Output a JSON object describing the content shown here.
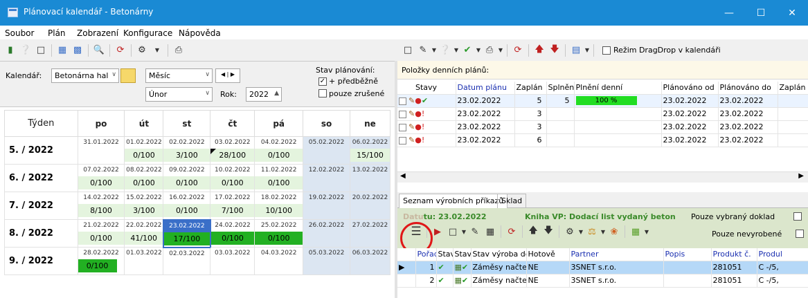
{
  "window": {
    "title": "Plánovací kalendář - Betonárny"
  },
  "menu": [
    "Soubor",
    "Plán",
    "Zobrazení",
    "Konfigurace",
    "Nápověda"
  ],
  "dragdrop_label": "Režim DragDrop v kalendáři",
  "controls": {
    "calendar_label": "Kalendář:",
    "calendar_value": "Betonárna hal",
    "view_value": "Měsíc",
    "month_value": "Únor",
    "year_label": "Rok:",
    "year_value": "2022",
    "state_label": "Stav plánování:",
    "opt_prelim": "+ předběžně",
    "opt_cancelled": "pouze zrušené"
  },
  "calendar": {
    "headers": [
      "Týden",
      "po",
      "út",
      "st",
      "čt",
      "pá",
      "so",
      "ne"
    ],
    "weeks": [
      {
        "label": "5. / 2022",
        "days": [
          [
            "31.01.2022",
            ""
          ],
          [
            "01.02.2022",
            "0/100"
          ],
          [
            "02.02.2022",
            "3/100"
          ],
          [
            "03.02.2022",
            "28/100"
          ],
          [
            "04.02.2022",
            "0/100"
          ],
          [
            "05.02.2022",
            ""
          ],
          [
            "06.02.2022",
            "15/100"
          ]
        ]
      },
      {
        "label": "6. / 2022",
        "days": [
          [
            "07.02.2022",
            "0/100"
          ],
          [
            "08.02.2022",
            "0/100"
          ],
          [
            "09.02.2022",
            "0/100"
          ],
          [
            "10.02.2022",
            "0/100"
          ],
          [
            "11.02.2022",
            "0/100"
          ],
          [
            "12.02.2022",
            ""
          ],
          [
            "13.02.2022",
            ""
          ]
        ]
      },
      {
        "label": "7. / 2022",
        "days": [
          [
            "14.02.2022",
            "8/100"
          ],
          [
            "15.02.2022",
            "3/100"
          ],
          [
            "16.02.2022",
            "0/100"
          ],
          [
            "17.02.2022",
            "7/100"
          ],
          [
            "18.02.2022",
            "10/100"
          ],
          [
            "19.02.2022",
            ""
          ],
          [
            "20.02.2022",
            ""
          ]
        ]
      },
      {
        "label": "8. / 2022",
        "days": [
          [
            "21.02.2022",
            "0/100"
          ],
          [
            "22.02.2022",
            "41/100"
          ],
          [
            "23.02.2022",
            "17/100"
          ],
          [
            "24.02.2022",
            "0/100"
          ],
          [
            "25.02.2022",
            "0/100"
          ],
          [
            "26.02.2022",
            ""
          ],
          [
            "27.02.2022",
            ""
          ]
        ]
      },
      {
        "label": "9. / 2022",
        "days": [
          [
            "28.02.2022",
            "0/100"
          ],
          [
            "01.03.2022",
            ""
          ],
          [
            "02.03.2022",
            ""
          ],
          [
            "03.03.2022",
            ""
          ],
          [
            "04.03.2022",
            ""
          ],
          [
            "05.03.2022",
            ""
          ],
          [
            "06.03.2022",
            ""
          ]
        ]
      }
    ]
  },
  "daily": {
    "title": "Položky denních plánů:",
    "columns": [
      "Stavy",
      "Datum plánu",
      "Zaplán",
      "Splněn",
      "Plnění denní",
      "Plánováno od",
      "Plánováno do",
      "Zaplán"
    ],
    "rows": [
      [
        "23.02.2022",
        "5",
        "5",
        "100 %",
        "23.02.2022",
        "23.02.2022"
      ],
      [
        "23.02.2022",
        "3",
        "",
        "",
        "23.02.2022",
        "23.02.2022"
      ],
      [
        "23.02.2022",
        "3",
        "",
        "",
        "23.02.2022",
        "23.02.2022"
      ],
      [
        "23.02.2022",
        "6",
        "",
        "",
        "23.02.2022",
        "23.02.2022"
      ]
    ],
    "progress": [
      1.0,
      0,
      0,
      0
    ]
  },
  "tabs": [
    "Seznam výrobních příkazů",
    "Sklad"
  ],
  "orders": {
    "date_prefix": "Datu",
    "date_text": "tu: 23.02.2022",
    "book": "Kniha VP: Dodací list vydaný beton",
    "only_selected": "Pouze vybraný doklad",
    "only_unproduced": "Pouze nevyrobené",
    "columns": [
      "Pořadí",
      "Stav",
      "Stav",
      "Stav výroba de",
      "Hotově",
      "Partner",
      "Popis",
      "Produkt č.",
      "Produl"
    ],
    "rows": [
      [
        "1",
        "Záměsy načten",
        "NE",
        "3SNET s.r.o.",
        "",
        "281051",
        "C -/5,"
      ],
      [
        "2",
        "Záměsy načten",
        "NE",
        "3SNET s.r.o.",
        "",
        "281051",
        "C -/5,"
      ]
    ]
  }
}
